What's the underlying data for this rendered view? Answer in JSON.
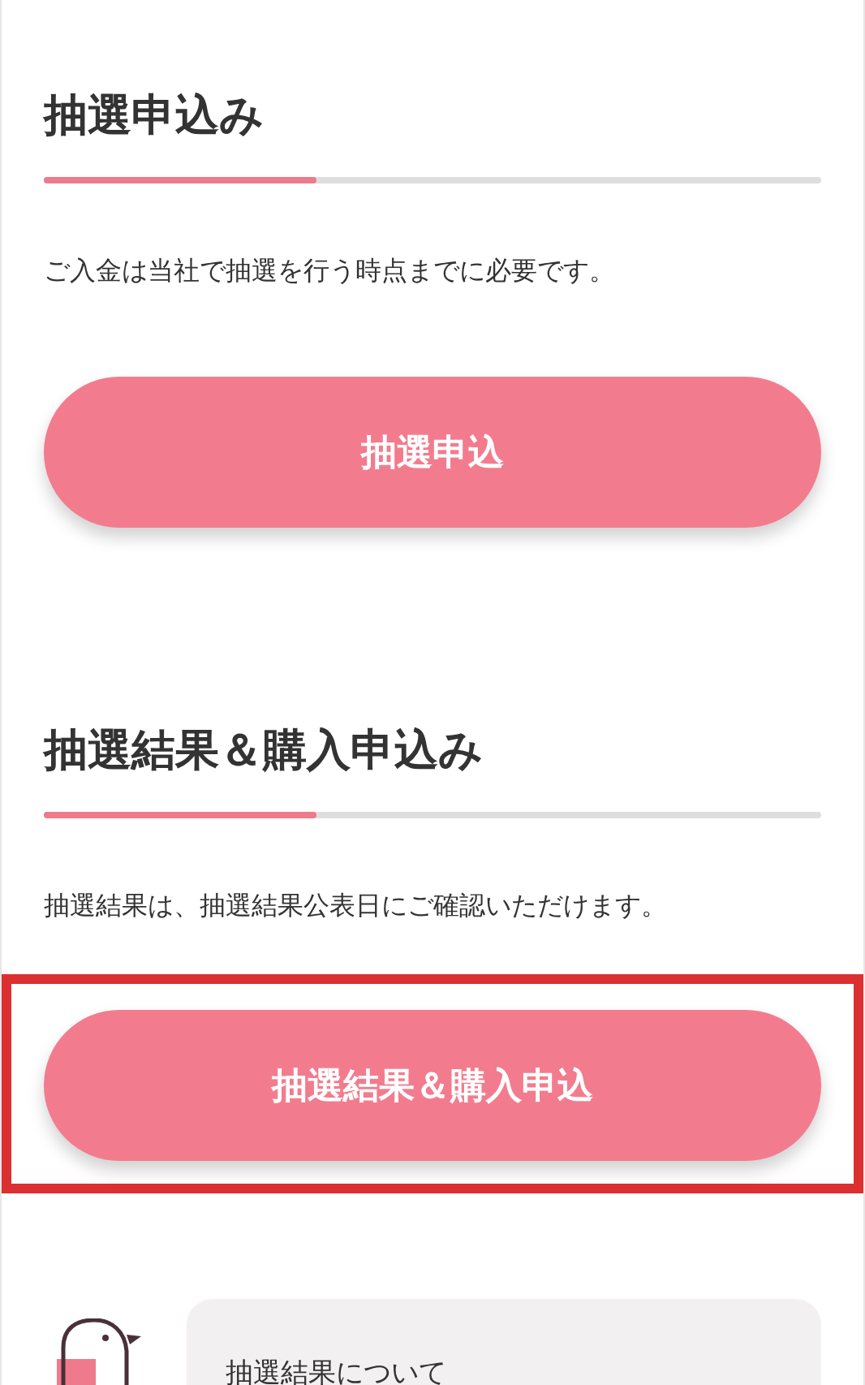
{
  "sections": [
    {
      "heading": "抽選申込み",
      "note": "ご入金は当社で抽選を行う時点までに必要です。",
      "button": "抽選申込",
      "highlighted": false
    },
    {
      "heading": "抽選結果＆購入申込み",
      "note": "抽選結果は、抽選結果公表日にご確認いただけます。",
      "button": "抽選結果＆購入申込",
      "highlighted": true
    }
  ],
  "bubble": {
    "text": "抽選結果について"
  }
}
